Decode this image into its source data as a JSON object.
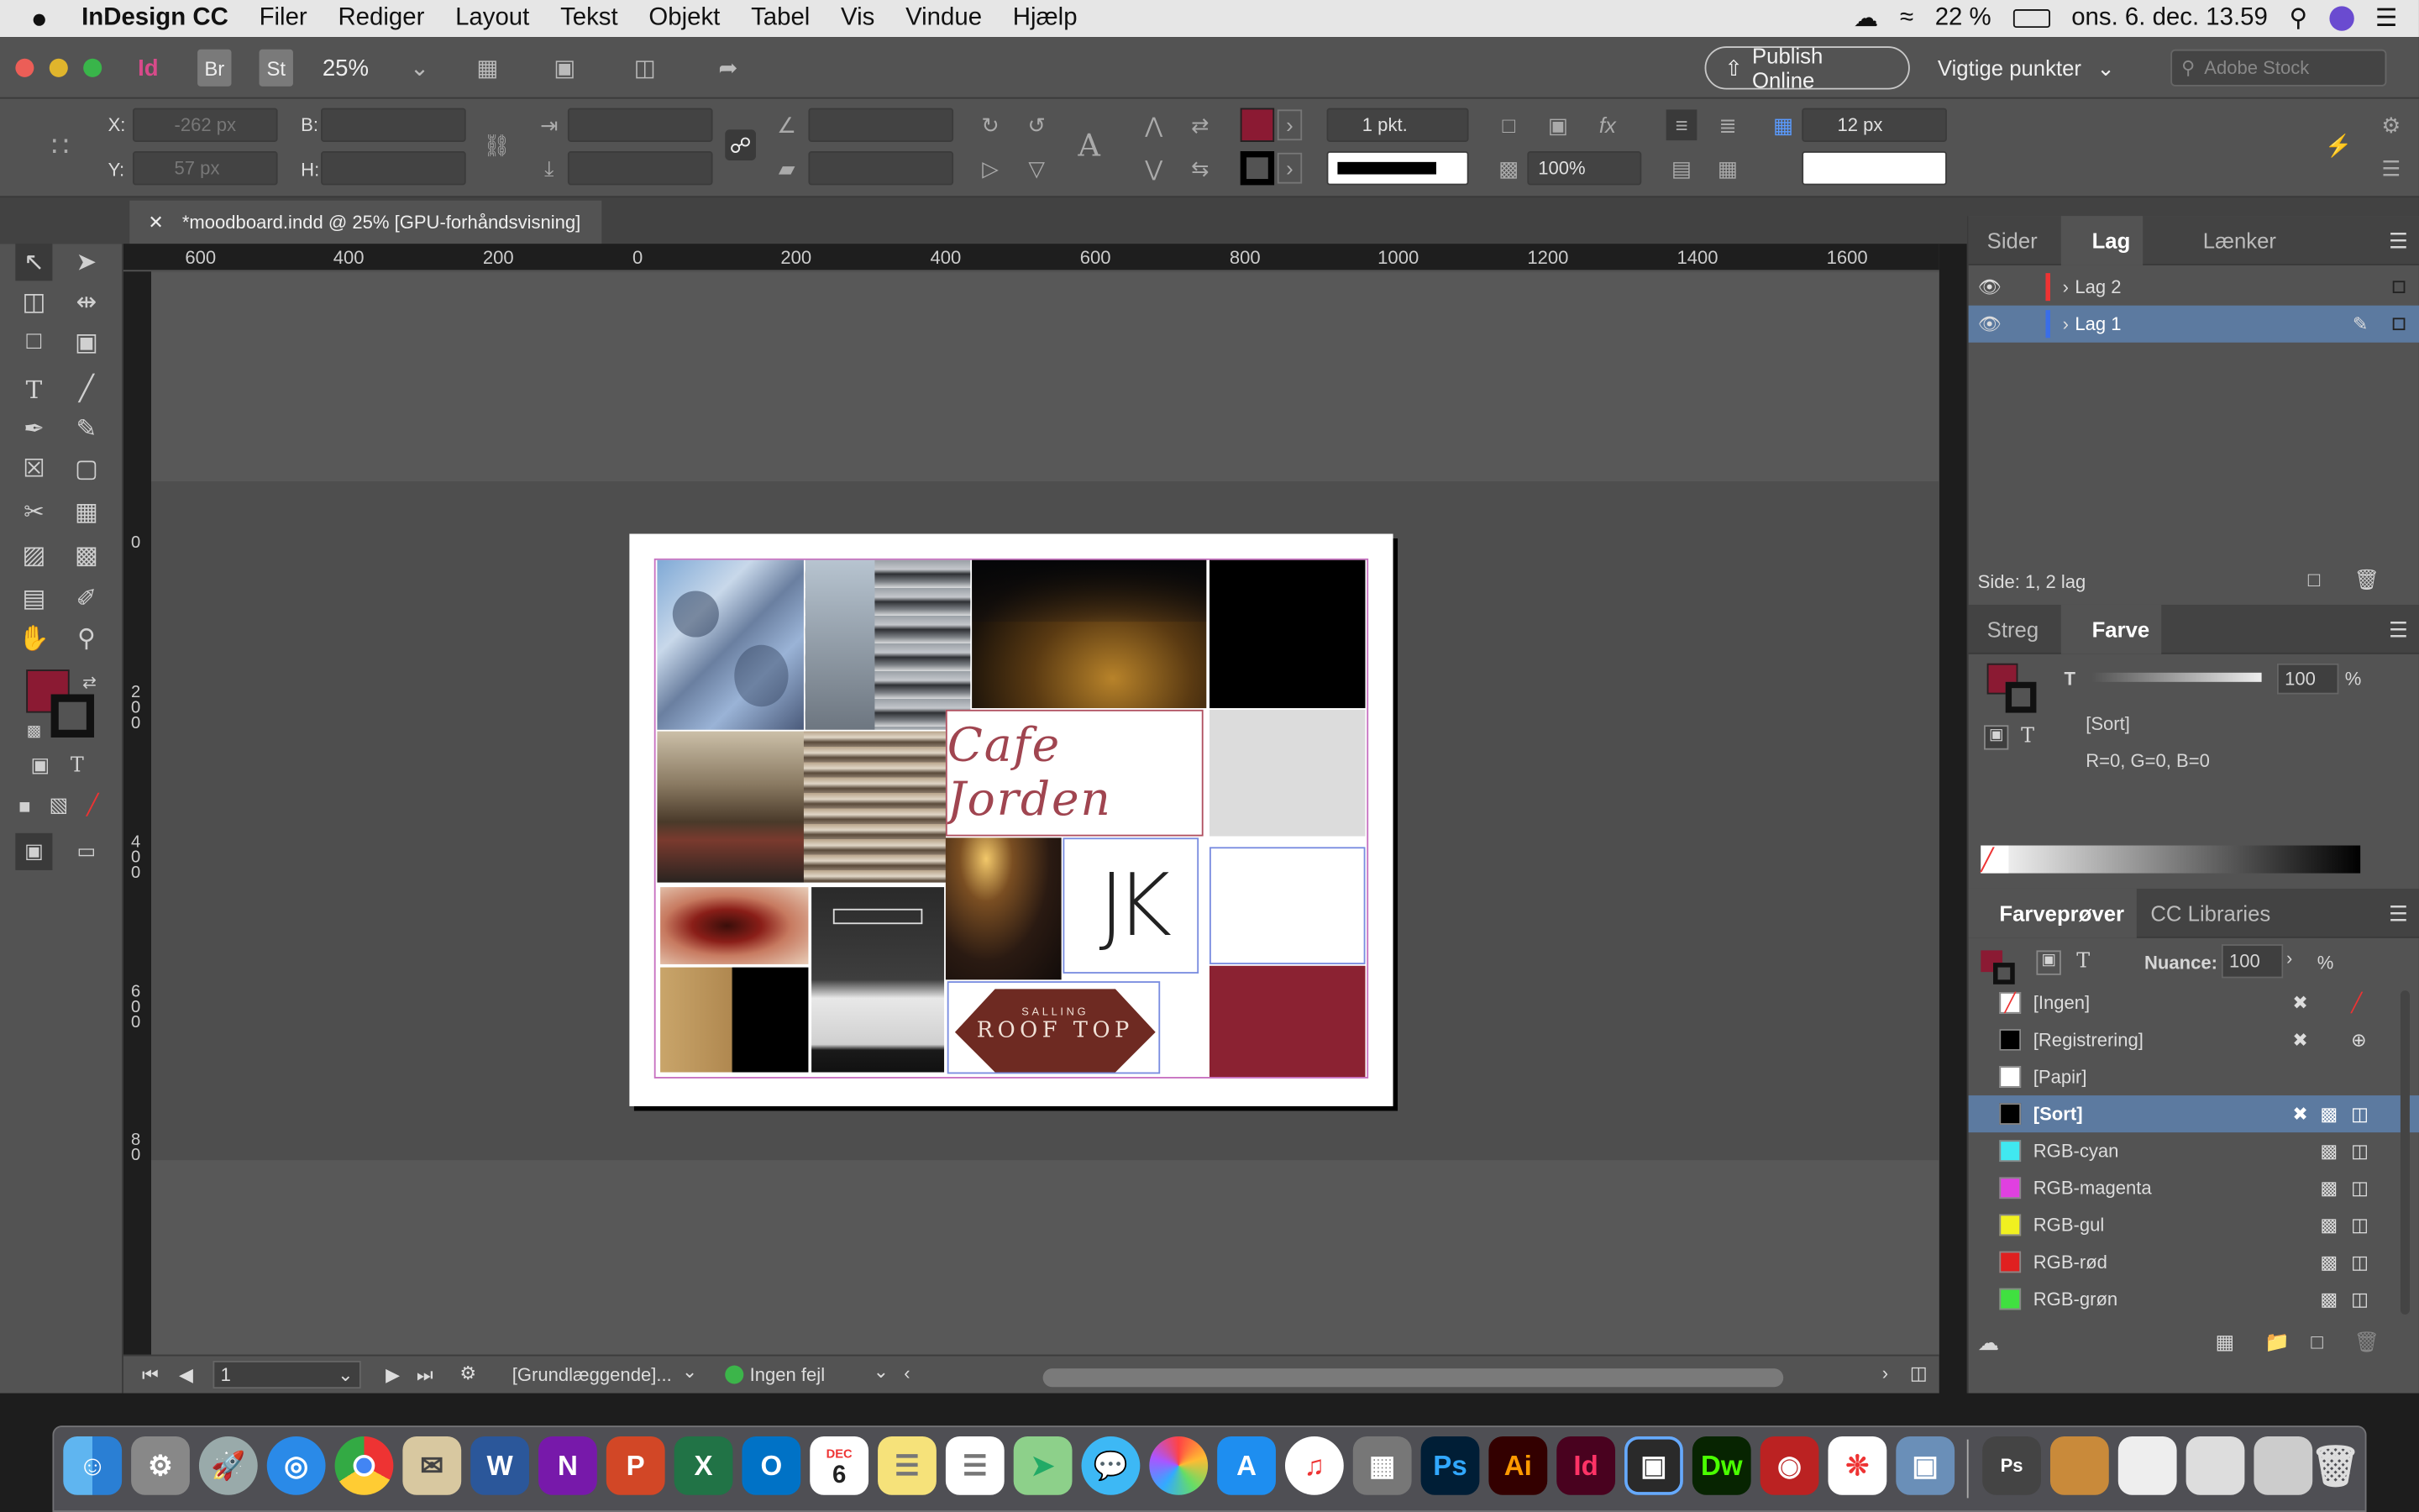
{
  "menubar": {
    "app_name": "InDesign CC",
    "items": [
      "Filer",
      "Rediger",
      "Layout",
      "Tekst",
      "Objekt",
      "Tabel",
      "Vis",
      "Vindue",
      "Hjælp"
    ],
    "battery": "22 %",
    "clock": "ons. 6. dec. 13.59"
  },
  "appbar": {
    "zoom": "25%",
    "publish_label": "Publish Online",
    "workspace_label": "Vigtige punkter",
    "search_placeholder": "Adobe Stock"
  },
  "control": {
    "x_label": "X:",
    "y_label": "Y:",
    "w_label": "B:",
    "h_label": "H:",
    "x_value": "-262 px",
    "y_value": "57 px",
    "stroke_weight": "1 pkt.",
    "opacity": "100%",
    "spacing": "12 px",
    "fill_color": "#8b1a33"
  },
  "document": {
    "tab_title": "*moodboard.indd @ 25% [GPU-forhåndsvisning]"
  },
  "hruler_labels": [
    "600",
    "400",
    "200",
    "0",
    "200",
    "400",
    "600",
    "800",
    "1000",
    "1200",
    "1400",
    "1600"
  ],
  "vruler_labels": [
    "0",
    "2\n0\n0",
    "4\n0\n0",
    "6\n0\n0",
    "8\n0"
  ],
  "moodboard": {
    "logo_text": "Cafe Jorden",
    "jk_text": "JK",
    "rooftop_top": "SALLING",
    "rooftop_main": "ROOF TOP",
    "accent_color": "#8b2232"
  },
  "status": {
    "page_number": "1",
    "preflight_profile": "[Grundlæggende]...",
    "errors": "Ingen fejl"
  },
  "panels": {
    "layers": {
      "tabs": [
        "Sider",
        "Lag",
        "Lænker"
      ],
      "items": [
        "Lag 2",
        "Lag 1"
      ],
      "footer": "Side: 1, 2 lag"
    },
    "color": {
      "tabs": [
        "Streg",
        "Farve"
      ],
      "t_label": "T",
      "tint": "100",
      "pct": "%",
      "swatch_name": "[Sort]",
      "rgb_text": "R=0, G=0, B=0"
    },
    "swatches": {
      "tabs": [
        "Farveprøver",
        "CC Libraries"
      ],
      "nuance_label": "Nuance:",
      "nuance_value": "100",
      "pct": "%",
      "items": [
        {
          "name": "[Ingen]",
          "color": "none"
        },
        {
          "name": "[Registrering]",
          "color": "#000000"
        },
        {
          "name": "[Papir]",
          "color": "#ffffff"
        },
        {
          "name": "[Sort]",
          "color": "#000000"
        },
        {
          "name": "RGB-cyan",
          "color": "#40e8f0"
        },
        {
          "name": "RGB-magenta",
          "color": "#e040e0"
        },
        {
          "name": "RGB-gul",
          "color": "#f0f020"
        },
        {
          "name": "RGB-rød",
          "color": "#e02020"
        },
        {
          "name": "RGB-grøn",
          "color": "#40e040"
        }
      ]
    }
  },
  "dock": {
    "apps": [
      "Finder",
      "Systemindstillinger",
      "Launchpad",
      "Safari",
      "Chrome",
      "Mail",
      "Word",
      "OneNote",
      "PowerPoint",
      "Excel",
      "Outlook",
      "Kalender",
      "Noter",
      "Påmindelser",
      "Kort",
      "Beskeder",
      "Fotos",
      "App Store",
      "iTunes",
      "Lommeregner",
      "Ps",
      "Ai",
      "Id",
      "Preview",
      "Dw",
      "Photo Booth",
      "Acrobat",
      "Billedoptager"
    ],
    "calendar_day": "6",
    "calendar_month": "DEC"
  }
}
